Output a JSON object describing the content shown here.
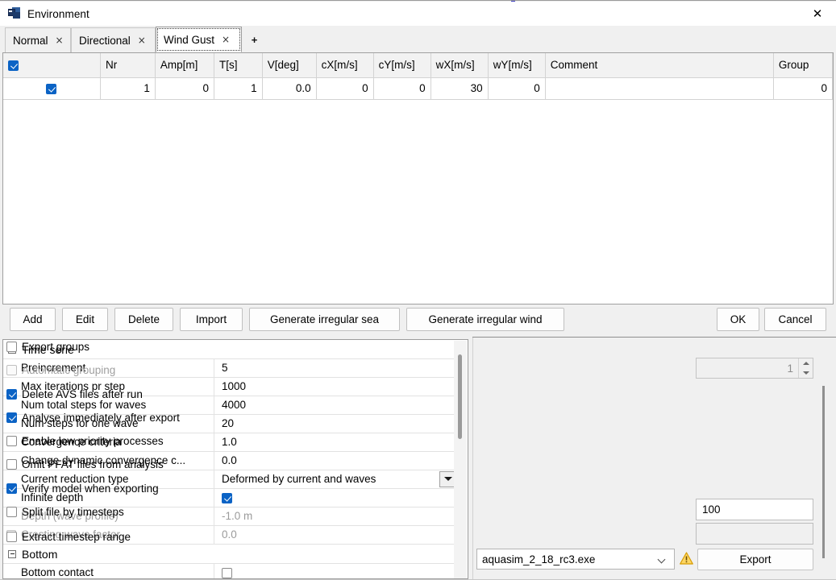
{
  "window": {
    "title": "Environment",
    "icon": "app-icon",
    "close_label": "✕"
  },
  "tabs": {
    "items": [
      {
        "label": "Normal",
        "close": "×",
        "active": false
      },
      {
        "label": "Directional",
        "close": "×",
        "active": false
      },
      {
        "label": "Wind Gust",
        "close": "×",
        "active": true
      }
    ],
    "add_label": "+"
  },
  "table": {
    "headers": [
      "",
      "Nr",
      "Amp[m]",
      "T[s]",
      "V[deg]",
      "cX[m/s]",
      "cY[m/s]",
      "wX[m/s]",
      "wY[m/s]",
      "Comment",
      "Group"
    ],
    "header_checkbox_checked": true,
    "rows": [
      {
        "checked": true,
        "nr": "1",
        "amp": "0",
        "t": "1",
        "v": "0.0",
        "cx": "0",
        "cy": "0",
        "wx": "30",
        "wy": "0",
        "comment": "",
        "group": "0"
      }
    ],
    "selected_cells": [
      "wx",
      "wy"
    ]
  },
  "toolbar": {
    "add": "Add",
    "edit": "Edit",
    "delete": "Delete",
    "import": "Import",
    "generate_sea": "Generate irregular sea",
    "generate_wind": "Generate irregular wind",
    "ok": "OK",
    "cancel": "Cancel"
  },
  "properties": {
    "categories": [
      {
        "name": "Time serie",
        "rows": [
          {
            "label": "Preincrement",
            "value": "5",
            "type": "text",
            "disabled": false,
            "has_label_checkbox": false
          },
          {
            "label": "Max iterations pr step",
            "value": "1000",
            "type": "text",
            "disabled": false,
            "has_label_checkbox": false
          },
          {
            "label": "Num total steps for waves",
            "value": "4000",
            "type": "text",
            "disabled": false,
            "has_label_checkbox": false
          },
          {
            "label": "Num steps for one wave",
            "value": "20",
            "type": "text",
            "disabled": false,
            "has_label_checkbox": false
          },
          {
            "label": "Convergence criteria",
            "value": "1.0",
            "type": "text",
            "disabled": false,
            "has_label_checkbox": false
          },
          {
            "label": "Change dynamic convergence c...",
            "value": "0.0",
            "type": "text",
            "disabled": false,
            "has_label_checkbox": false
          },
          {
            "label": "Current reduction type",
            "value": "Deformed by current and waves",
            "type": "combo",
            "disabled": false,
            "has_label_checkbox": false
          },
          {
            "label": "Infinite depth",
            "value": "",
            "type": "checkbox",
            "checked": true,
            "disabled": false,
            "has_label_checkbox": false
          },
          {
            "label": "Depth (wave profile)",
            "value": "-1.0 m",
            "type": "text",
            "disabled": true,
            "has_label_checkbox": false
          },
          {
            "label": "Cresting wave factor",
            "value": "0.0",
            "type": "text",
            "disabled": true,
            "has_label_checkbox": true
          }
        ]
      },
      {
        "name": "Bottom",
        "rows": [
          {
            "label": "Bottom contact",
            "value": "",
            "type": "checkbox",
            "checked": false,
            "disabled": false,
            "has_label_checkbox": false
          }
        ]
      }
    ]
  },
  "export_panel": {
    "options": [
      {
        "label": "Export groups",
        "checked": false,
        "disabled": false
      },
      {
        "label": "Automatic grouping",
        "checked": false,
        "disabled": true
      },
      {
        "label": "Delete AVS files after run",
        "checked": true,
        "disabled": false
      },
      {
        "label": "Analyse immediately after export",
        "checked": true,
        "disabled": false
      },
      {
        "label": "Enable low priority processes",
        "checked": false,
        "disabled": false
      },
      {
        "label": "Omit PFAT files from analysis",
        "checked": false,
        "disabled": false
      },
      {
        "label": "Verify model when exporting",
        "checked": true,
        "disabled": false
      },
      {
        "label": "Split file by timesteps",
        "checked": false,
        "disabled": false
      },
      {
        "label": "Extract timestep range",
        "checked": false,
        "disabled": false
      }
    ],
    "grouping_spinner_value": "1",
    "split_timesteps_value": "100",
    "extract_range_value": "",
    "executable": "aquasim_2_18_rc3.exe",
    "export_button": "Export",
    "warning_icon": "warning-triangle-icon"
  },
  "colors": {
    "accent": "#0b63c5",
    "selection_gray": "#cccccc",
    "warning": "#e8a200"
  }
}
